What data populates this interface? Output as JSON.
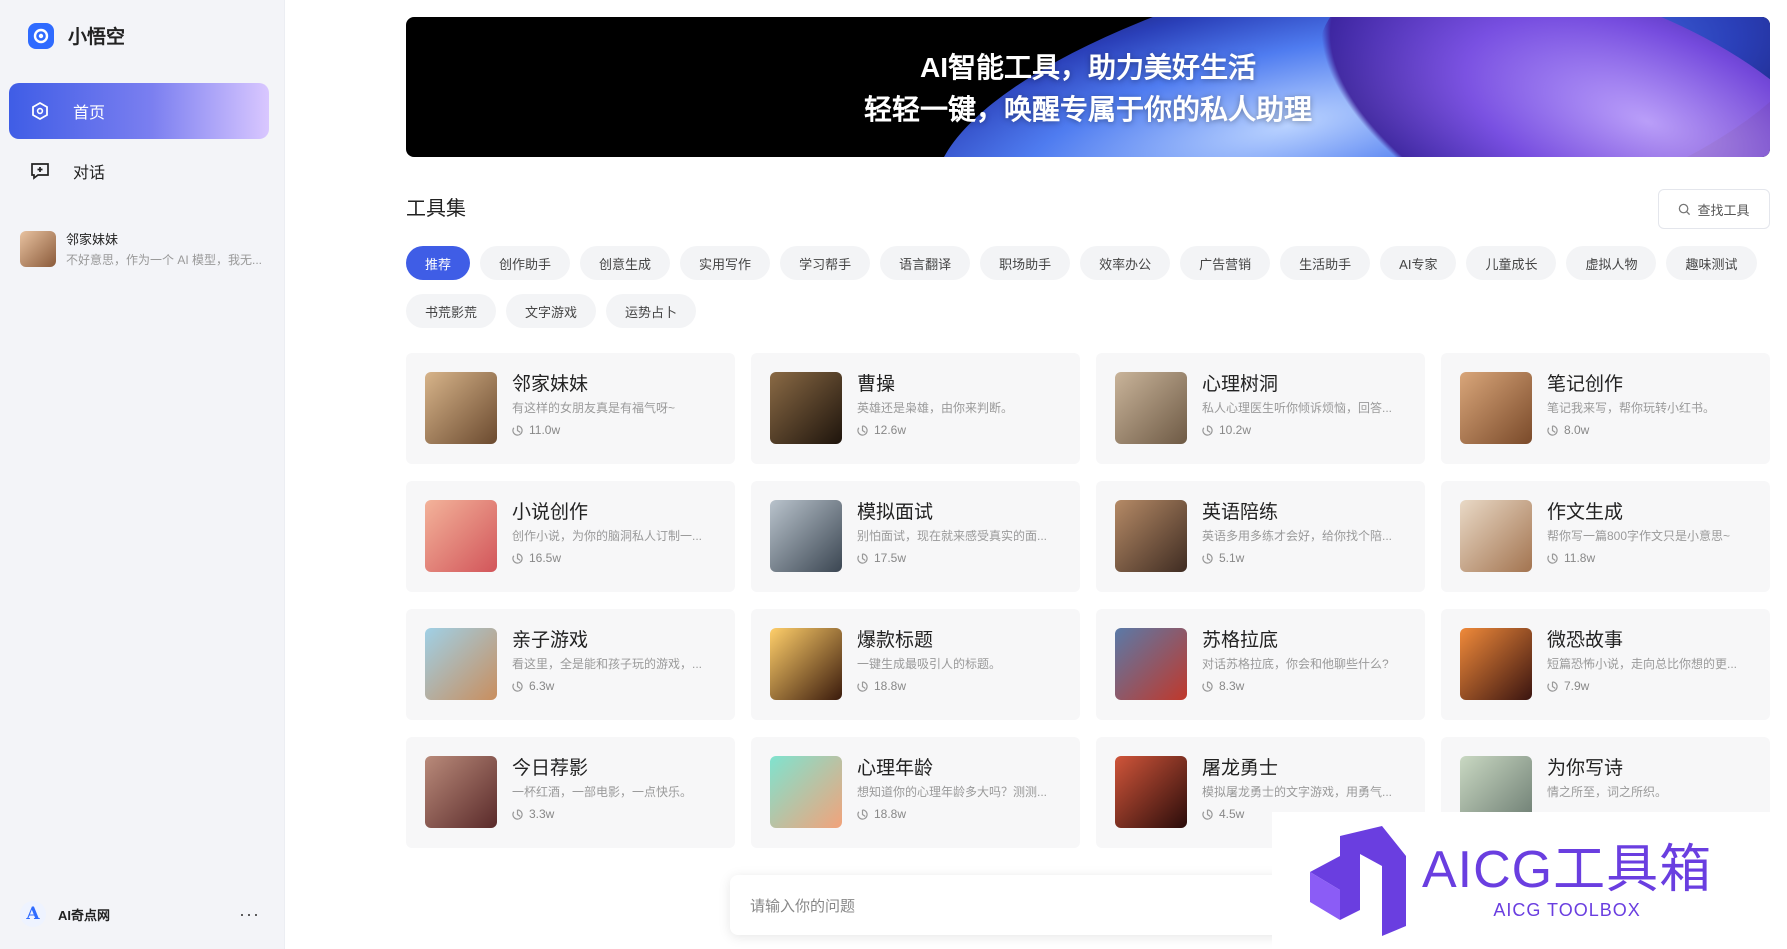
{
  "sidebar": {
    "brand": "小悟空",
    "nav": [
      {
        "label": "首页",
        "icon": "hexagon-icon",
        "active": true
      },
      {
        "label": "对话",
        "icon": "chat-add-icon",
        "active": false
      }
    ],
    "recent": {
      "title": "邻家妹妹",
      "preview": "不好意思，作为一个 AI 模型，我无..."
    },
    "user": {
      "name": "AI奇点网",
      "menu": "···"
    }
  },
  "banner": {
    "line1": "AI智能工具，助力美好生活",
    "line2": "轻轻一键，唤醒专属于你的私人助理"
  },
  "toolset": {
    "title": "工具集",
    "search_label": "查找工具"
  },
  "tags": [
    "推荐",
    "创作助手",
    "创意生成",
    "实用写作",
    "学习帮手",
    "语言翻译",
    "职场助手",
    "效率办公",
    "广告营销",
    "生活助手",
    "AI专家",
    "儿童成长",
    "虚拟人物",
    "趣味测试",
    "书荒影荒",
    "文字游戏",
    "运势占卜"
  ],
  "active_tag": "推荐",
  "cards": [
    {
      "name": "邻家妹妹",
      "desc": "有这样的女朋友真是有福气呀~",
      "count": "11.0w",
      "thumb": [
        "#d7b48a",
        "#6b4a2f"
      ]
    },
    {
      "name": "曹操",
      "desc": "英雄还是枭雄，由你来判断。",
      "count": "12.6w",
      "thumb": [
        "#8a6a45",
        "#1e140c"
      ]
    },
    {
      "name": "心理树洞",
      "desc": "私人心理医生听你倾诉烦恼，回答...",
      "count": "10.2w",
      "thumb": [
        "#c9b49a",
        "#6e5a45"
      ]
    },
    {
      "name": "笔记创作",
      "desc": "笔记我来写，帮你玩转小红书。",
      "count": "8.0w",
      "thumb": [
        "#d9a67a",
        "#7a4a2a"
      ]
    },
    {
      "name": "小说创作",
      "desc": "创作小说，为你的脑洞私人订制一...",
      "count": "16.5w",
      "thumb": [
        "#f3b39a",
        "#d2555a"
      ]
    },
    {
      "name": "模拟面试",
      "desc": "别怕面试，现在就来感受真实的面...",
      "count": "17.5w",
      "thumb": [
        "#b9c3cc",
        "#3b4652"
      ]
    },
    {
      "name": "英语陪练",
      "desc": "英语多用多练才会好，给你找个陪...",
      "count": "5.1w",
      "thumb": [
        "#b58a66",
        "#3f2c22"
      ]
    },
    {
      "name": "作文生成",
      "desc": "帮你写一篇800字作文只是小意思~",
      "count": "11.8w",
      "thumb": [
        "#e9d9c6",
        "#a37450"
      ]
    },
    {
      "name": "亲子游戏",
      "desc": "看这里，全是能和孩子玩的游戏，...",
      "count": "6.3w",
      "thumb": [
        "#9fd0e6",
        "#c98e5e"
      ]
    },
    {
      "name": "爆款标题",
      "desc": "一键生成最吸引人的标题。",
      "count": "18.8w",
      "thumb": [
        "#ffcf6a",
        "#3a1a0c"
      ]
    },
    {
      "name": "苏格拉底",
      "desc": "对话苏格拉底，你会和他聊些什么?",
      "count": "8.3w",
      "thumb": [
        "#5a7aa8",
        "#c0382b"
      ]
    },
    {
      "name": "微恐故事",
      "desc": "短篇恐怖小说，走向总比你想的更...",
      "count": "7.9w",
      "thumb": [
        "#f08a3a",
        "#3a1410"
      ]
    },
    {
      "name": "今日荐影",
      "desc": "一杯红酒，一部电影，一点快乐。",
      "count": "3.3w",
      "thumb": [
        "#b98a7a",
        "#5a2a2a"
      ]
    },
    {
      "name": "心理年龄",
      "desc": "想知道你的心理年龄多大吗？测测...",
      "count": "18.8w",
      "thumb": [
        "#7fe3cf",
        "#f2a27a"
      ]
    },
    {
      "name": "屠龙勇士",
      "desc": "模拟屠龙勇士的文字游戏，用勇气...",
      "count": "4.5w",
      "thumb": [
        "#d0553a",
        "#2a0c0a"
      ]
    },
    {
      "name": "为你写诗",
      "desc": "情之所至，词之所织。",
      "count": "",
      "thumb": [
        "#c9d8c2",
        "#6a7a70"
      ]
    }
  ],
  "chat_input": {
    "placeholder": "请输入你的问题"
  },
  "watermark": {
    "title": "AICG工具箱",
    "subtitle": "AICG TOOLBOX"
  },
  "colors": {
    "accent": "#3f5de6",
    "brand_blue": "#2f6bff",
    "watermark": "#6a3ee0"
  }
}
